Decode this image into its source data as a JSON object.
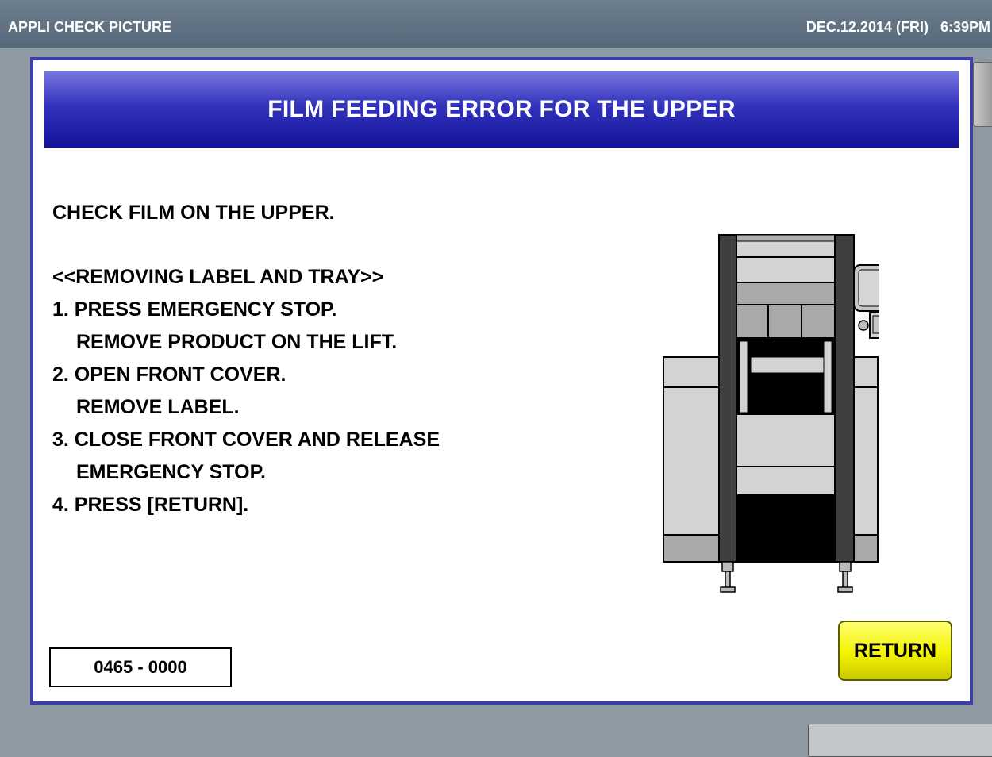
{
  "topbar": {
    "title": "APPLI CHECK PICTURE",
    "datetime": "DEC.12.2014 (FRI)   6:39PM"
  },
  "dialog": {
    "title": "FILM FEEDING ERROR FOR THE UPPER",
    "lines": [
      "CHECK FILM ON THE UPPER.",
      "<<REMOVING LABEL AND TRAY>>",
      "1. PRESS EMERGENCY STOP.",
      "REMOVE PRODUCT ON THE LIFT.",
      "2. OPEN FRONT COVER.",
      "REMOVE LABEL.",
      "3. CLOSE FRONT COVER AND RELEASE",
      "EMERGENCY STOP.",
      "4. PRESS [RETURN]."
    ],
    "error_code": "0465 - 0000",
    "return_label": "RETURN"
  },
  "colors": {
    "header_gradient_top": "#7777e0",
    "header_gradient_bottom": "#14149a",
    "dialog_border": "#3d3da6",
    "return_button": "#f3f300",
    "screen_background": "#8d9aa3"
  },
  "icons": {
    "machine_illustration": "packaging-machine-icon"
  }
}
